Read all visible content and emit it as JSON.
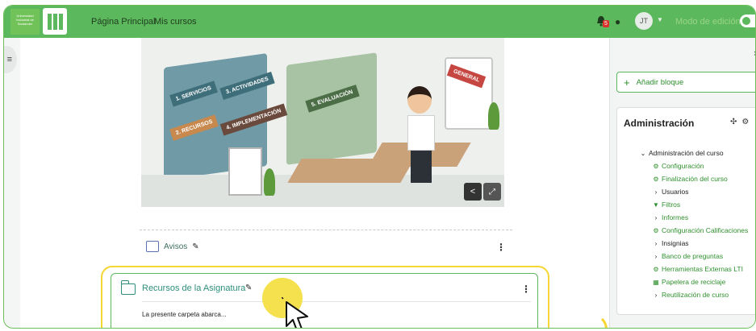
{
  "logo": {
    "text": "Universidad Industrial de Santander"
  },
  "nav": {
    "home": "Página Principal",
    "courses": "Mis cursos"
  },
  "user": {
    "notifications_count": "5",
    "initials": "JT",
    "edit_mode_label": "Modo de edición"
  },
  "main": {
    "avisos": {
      "label": "Avisos"
    },
    "resource": {
      "title": "Recursos de la Asignatura",
      "description": "La presente carpeta abarca..."
    },
    "banner_labels": [
      "SERVICIOS",
      "RECURSOS",
      "ACTIVIDADES",
      "IMPLEMENTACIÓN",
      "EVALUACIÓN",
      "GENERAL"
    ],
    "banner_numbers": [
      "1.",
      "2.",
      "3.",
      "4.",
      "5."
    ]
  },
  "drawer": {
    "add_block": "Añadir bloque",
    "admin": {
      "title": "Administración",
      "items": [
        {
          "label": "Administración del curso",
          "level": 0,
          "icon": "chevron-down-icon",
          "color": "dark"
        },
        {
          "label": "Configuración",
          "level": 1,
          "icon": "gear-icon",
          "color": "green"
        },
        {
          "label": "Finalización del curso",
          "level": 1,
          "icon": "gear-icon",
          "color": "green"
        },
        {
          "label": "Usuarios",
          "level": 1,
          "icon": "chevron-right-icon",
          "color": "dark"
        },
        {
          "label": "Filtros",
          "level": 1,
          "icon": "filter-icon",
          "color": "green"
        },
        {
          "label": "Informes",
          "level": 1,
          "icon": "chevron-right-icon",
          "color": "green"
        },
        {
          "label": "Configuración Calificaciones",
          "level": 1,
          "icon": "gear-icon",
          "color": "green"
        },
        {
          "label": "Insignias",
          "level": 1,
          "icon": "chevron-right-icon",
          "color": "dark"
        },
        {
          "label": "Banco de preguntas",
          "level": 1,
          "icon": "chevron-right-icon",
          "color": "green"
        },
        {
          "label": "Herramientas Externas LTI",
          "level": 1,
          "icon": "gear-icon",
          "color": "green"
        },
        {
          "label": "Papelera de reciclaje",
          "level": 1,
          "icon": "trash-icon",
          "color": "green"
        },
        {
          "label": "Reutilización de curso",
          "level": 1,
          "icon": "chevron-right-icon",
          "color": "green"
        }
      ]
    }
  },
  "colors": {
    "brand_green": "#5cb85c",
    "highlight_yellow": "#f5d632",
    "link_teal": "#2d8f7b"
  }
}
